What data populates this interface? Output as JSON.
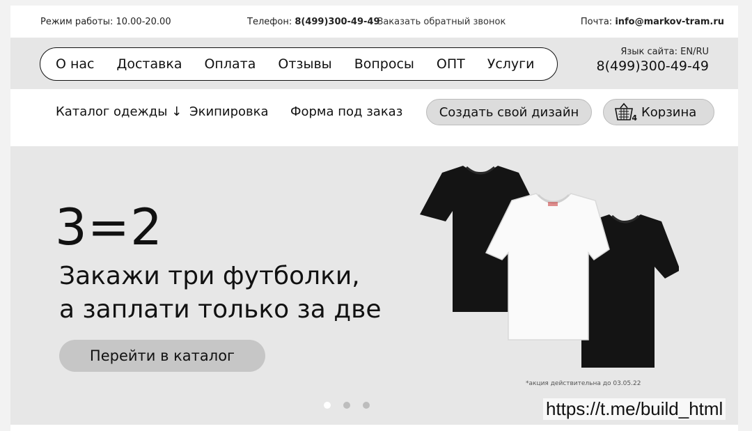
{
  "topbar": {
    "hours": "Режим работы: 10.00-20.00",
    "phone_label": "Телефон: ",
    "phone": "8(499)300-49-49",
    "callback": "Заказать обратный звонок",
    "mail_label": "Почта: ",
    "mail": "info@markov-tram.ru"
  },
  "nav": {
    "items": [
      "О нас",
      "Доставка",
      "Оплата",
      "Отзывы",
      "Вопросы",
      "ОПТ",
      "Услуги"
    ],
    "lang": "Язык сайта: EN/RU",
    "phone": "8(499)300-49-49"
  },
  "catalog": {
    "catalog_label": "Каталог одежды ↓",
    "equipment_label": "Экипировка",
    "custom_order_label": "Форма под заказ",
    "create_design_label": "Создать свой дизайн",
    "cart_label": "Корзина",
    "cart_count": "4"
  },
  "hero": {
    "big": "3=2",
    "line1": "Закажи три футболки,",
    "line2": "а заплати только за две",
    "cta": "Перейти в каталог",
    "note": "*акция действительна до 03.05.22",
    "slides": 3,
    "active_slide": 1
  },
  "watermark": "https://t.me/build_html",
  "icons": {
    "cart": "basket-icon",
    "shirts": "tshirt-image"
  },
  "colors": {
    "accent_button": "#c6c6c6",
    "hero_bg": "#e7e7e7",
    "nav_bg": "#e6e6e6"
  }
}
